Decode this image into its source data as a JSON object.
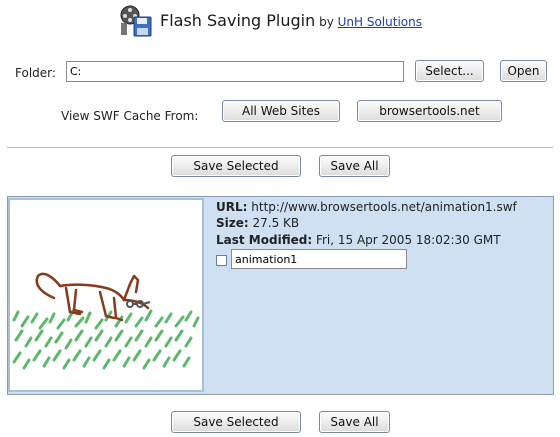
{
  "header": {
    "title": "Flash Saving Plugin",
    "by": "by",
    "author_link": "UnH Solutions",
    "icon": "film-reel-floppy-icon"
  },
  "folder": {
    "label": "Folder:",
    "value": "C:",
    "select_label": "Select...",
    "open_label": "Open"
  },
  "cache": {
    "label": "View SWF Cache From:",
    "all_sites_label": "All Web Sites",
    "site_label": "browsertools.net"
  },
  "actions": {
    "save_selected_label": "Save Selected",
    "save_all_label": "Save All"
  },
  "item": {
    "url_label": "URL:",
    "url": "http://www.browsertools.net/animation1.swf",
    "size_label": "Size:",
    "size": "27.5 KB",
    "modified_label": "Last Modified:",
    "modified": "Fri, 15 Apr 2005 18:02:30 GMT",
    "checked": false,
    "name_value": "animation1",
    "thumbnail": "dog-on-grass-drawing"
  },
  "colors": {
    "panel_bg": "#cfe0f2",
    "link": "#1a3fb0",
    "grass": "#5cb86a",
    "dog": "#8a3a1a"
  }
}
